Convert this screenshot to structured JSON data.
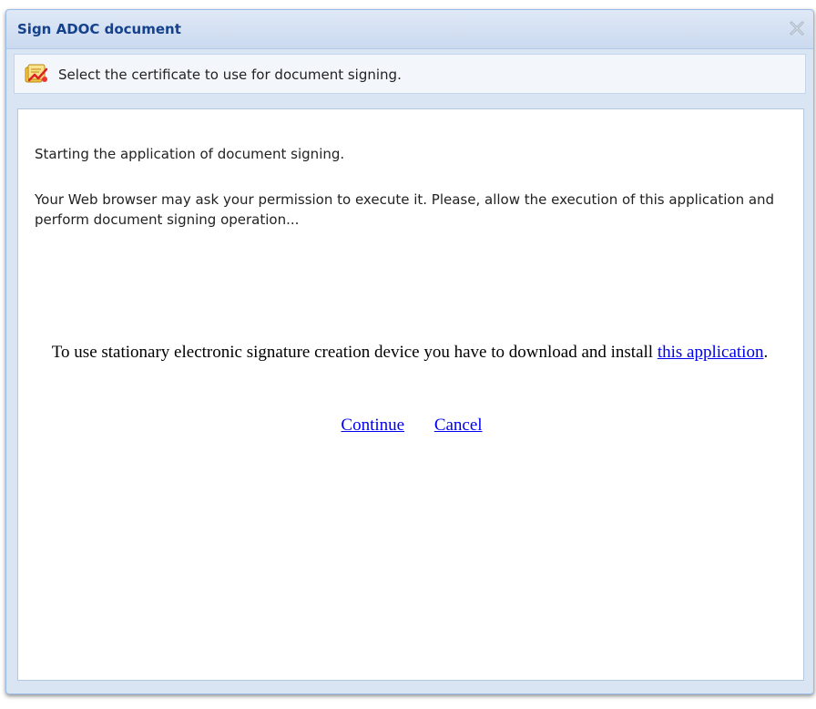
{
  "dialog": {
    "title": "Sign ADOC document",
    "subheader_text": "Select the certificate to use for document signing."
  },
  "content": {
    "paragraph1": "Starting the application of document signing.",
    "paragraph2": "Your Web browser may ask your permission to execute it. Please, allow the execution of this application and perform document signing operation...",
    "install_text_before": "To use stationary electronic signature creation device you have to download and install ",
    "install_link": "this application",
    "install_text_after": ".",
    "continue_link": "Continue",
    "cancel_link": "Cancel"
  },
  "icons": {
    "close": "close-icon",
    "certificate": "certificate-sign-icon"
  },
  "colors": {
    "title_text": "#15428b",
    "link": "#0000ee",
    "window_bg": "#d9e5f3"
  }
}
